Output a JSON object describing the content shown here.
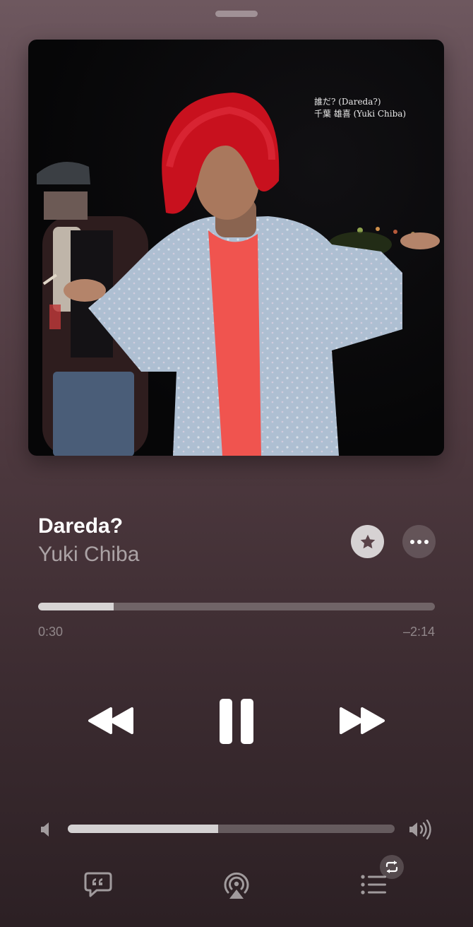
{
  "artwork": {
    "caption_line1": "誰だ? (Dareda?)",
    "caption_line2": "千葉 雄喜 (Yuki Chiba)"
  },
  "track": {
    "title": "Dareda?",
    "artist": "Yuki Chiba"
  },
  "playback": {
    "elapsed": "0:30",
    "remaining": "–2:14",
    "progress_fraction": 0.19,
    "state": "playing"
  },
  "volume": {
    "level_fraction": 0.46
  },
  "icons": {
    "favorite": "star-icon",
    "more": "ellipsis-icon",
    "rewind": "rewind-icon",
    "pause": "pause-icon",
    "forward": "fast-forward-icon",
    "volume_low": "speaker-low-icon",
    "volume_high": "speaker-high-icon",
    "lyrics": "quote-bubble-icon",
    "airplay": "airplay-icon",
    "queue": "list-icon",
    "repeat": "repeat-icon"
  },
  "colors": {
    "background_top": "#6e585f",
    "background_bottom": "#2c2024",
    "hair": "#c8111e",
    "shirt": "#f0544f",
    "jacket": "#aebfd2"
  }
}
